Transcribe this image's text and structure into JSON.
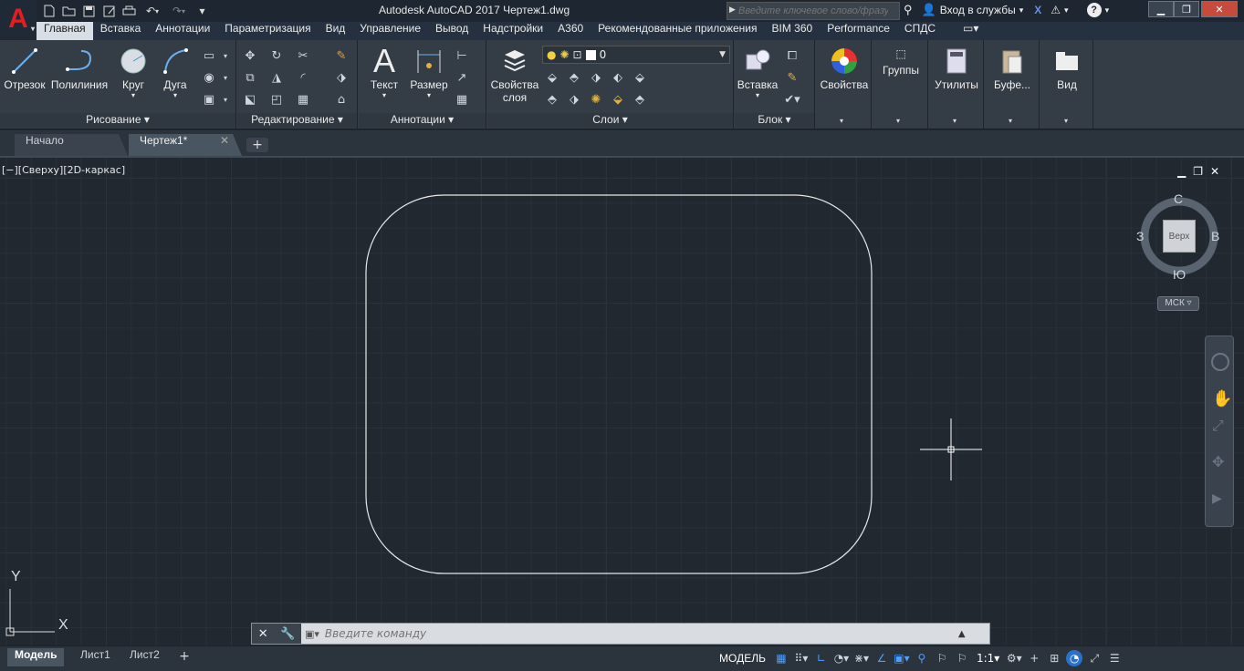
{
  "app": {
    "title": "Autodesk AutoCAD 2017    Чертеж1.dwg",
    "logo": "A"
  },
  "qat": {
    "icons": [
      "new-icon",
      "open-icon",
      "save-icon",
      "save-as-icon",
      "print-icon",
      "undo-icon",
      "redo-icon",
      "customize-qat-icon"
    ]
  },
  "search": {
    "placeholder": "Введите ключевое слово/фразу"
  },
  "signin": {
    "label": "Вход в службы"
  },
  "ribbon_tabs": [
    "Главная",
    "Вставка",
    "Аннотации",
    "Параметризация",
    "Вид",
    "Управление",
    "Вывод",
    "Надстройки",
    "A360",
    "Рекомендованные приложения",
    "BIM 360",
    "Performance",
    "СПДС"
  ],
  "panels": {
    "draw": {
      "title": "Рисование",
      "line": "Отрезок",
      "polyline": "Полилиния",
      "circle": "Круг",
      "arc": "Дуга"
    },
    "modify": {
      "title": "Редактирование"
    },
    "annotation": {
      "title": "Аннотации",
      "text": "Текст",
      "dimension": "Размер"
    },
    "layers": {
      "title": "Слои",
      "layer_props": "Свойства\nслоя",
      "current_layer": "0"
    },
    "block": {
      "title": "Блок",
      "insert": "Вставка"
    },
    "properties": {
      "label": "Свойства"
    },
    "groups": {
      "label": "Группы"
    },
    "utilities": {
      "label": "Утилиты"
    },
    "clipboard": {
      "label": "Буфе..."
    },
    "view": {
      "label": "Вид"
    }
  },
  "doc_tabs": {
    "start": "Начало",
    "drawing": "Чертеж1*"
  },
  "viewport": {
    "label": "[−][Сверху][2D-каркас]"
  },
  "viewcube": {
    "north": "С",
    "south": "Ю",
    "west": "З",
    "east": "В",
    "face": "Верх",
    "ucs": "МСК"
  },
  "ucs_icon": {
    "x": "X",
    "y": "Y"
  },
  "command": {
    "placeholder": "Введите команду"
  },
  "layout_tabs": [
    "Модель",
    "Лист1",
    "Лист2"
  ],
  "status": {
    "model": "МОДЕЛЬ",
    "scale": "1:1"
  }
}
